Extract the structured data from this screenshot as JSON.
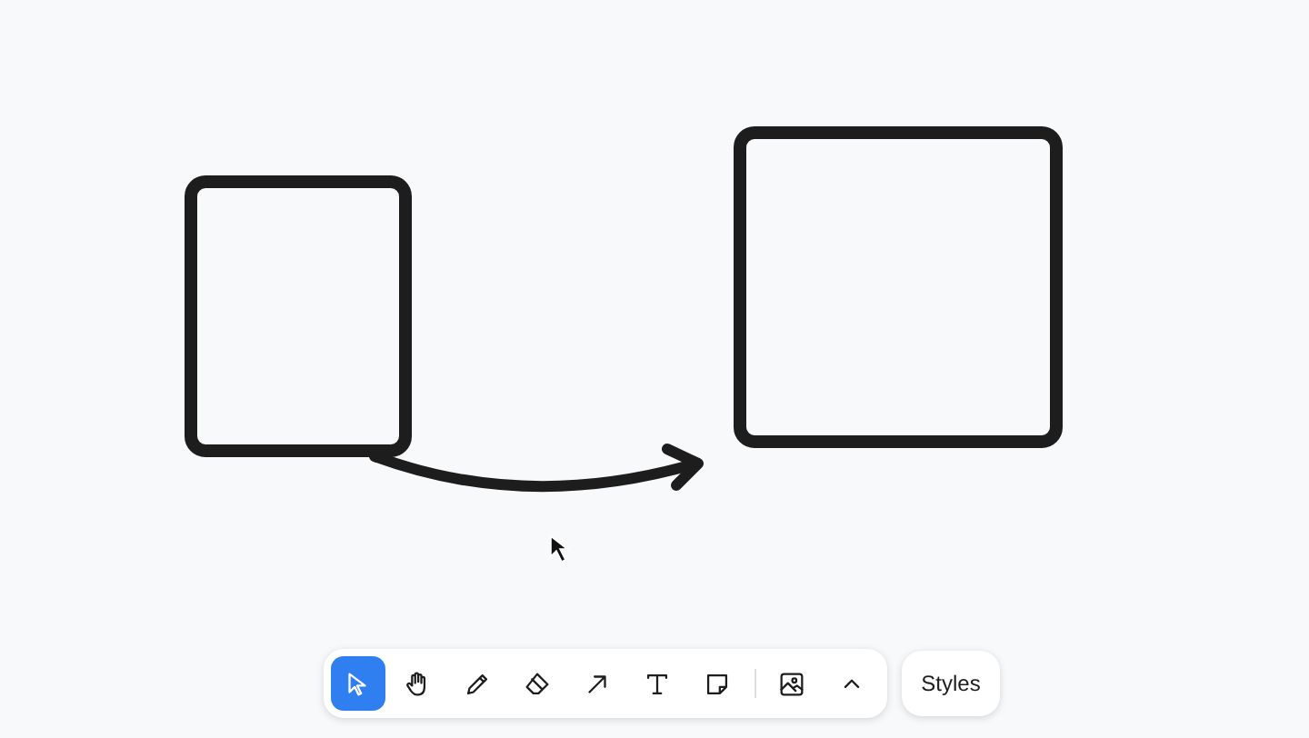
{
  "tools": [
    {
      "kind": "select",
      "selected": true
    },
    {
      "kind": "hand",
      "selected": false
    },
    {
      "kind": "draw",
      "selected": false
    },
    {
      "kind": "eraser",
      "selected": false
    },
    {
      "kind": "arrow",
      "selected": false
    },
    {
      "kind": "text",
      "selected": false
    },
    {
      "kind": "note",
      "selected": false
    },
    {
      "kind": "divider"
    },
    {
      "kind": "image",
      "selected": false
    },
    {
      "kind": "more",
      "selected": false
    }
  ],
  "styles_button": {
    "label": "Styles"
  }
}
